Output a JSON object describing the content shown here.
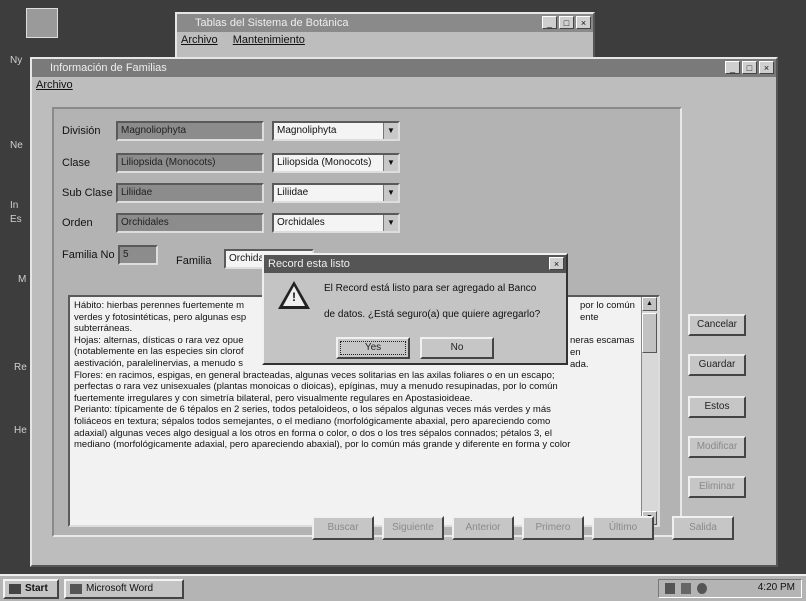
{
  "back_window": {
    "title": "Tablas del Sistema de Botánica",
    "menu": [
      "Archivo",
      "Mantenimiento"
    ]
  },
  "main_window": {
    "title": "Información de Familias",
    "menu": [
      "Archivo"
    ],
    "fields": {
      "division": {
        "label": "División",
        "value": "Magnoliophyta",
        "combo": "Magnoliphyta"
      },
      "clase": {
        "label": "Clase",
        "value": "Liliopsida (Monocots)",
        "combo": "Liliopsida (Monocots)"
      },
      "subclase": {
        "label": "Sub Clase",
        "value": "Liliidae",
        "combo": "Liliidae"
      },
      "orden": {
        "label": "Orden",
        "value": "Orchidales",
        "combo": "Orchidales"
      },
      "familia_no": {
        "label": "Familia No",
        "value": "5"
      },
      "familia": {
        "label": "Familia",
        "value": "Orchida"
      }
    },
    "description": [
      "Hábito: hierbas perennes fuertemente m",
      "verdes y fotosintéticas, pero algunas esp",
      "subterráneas.",
      "Hojas: alternas, dísticas o rara vez opue",
      "(notablemente en las especies sin clorof",
      "aestivación, paralelinervias, a menudo s",
      "Flores: en racimos, espigas, en general bracteadas, algunas veces solitarias en las axilas foliares o en un escapo;",
      "perfectas o rara vez unisexuales (plantas monoicas o dioicas), epíginas, muy a menudo resupinadas, por lo común",
      "fuertemente irregulares y con simetría bilateral, pero visualmente regulares en Apostasioideae.",
      "Perianto: típicamente de 6 tépalos en 2 series, todos petaloideos, o los sépalos algunas veces más verdes y más",
      "foliáceos en textura; sépalos todos semejantes, o el mediano (morfológicamente abaxial, pero apareciendo como",
      "adaxial) algunas veces algo desigual a los otros en forma o color, o dos o los tres sépalos connados; pétalos 3, el",
      "mediano (morfológicamente adaxial, pero apareciendo abaxial), por lo común más grande y diferente en forma y color"
    ],
    "description_right": [
      "por lo común",
      "ente",
      "neras escamas",
      "en",
      "ada."
    ],
    "side_buttons": [
      "Cancelar",
      "Guardar",
      "Estos",
      "Modificar",
      "Eliminar"
    ],
    "bottom_buttons": [
      "Buscar",
      "Siguiente",
      "Anterior",
      "Primero",
      "Último",
      "Salida"
    ]
  },
  "dialog": {
    "title": "Record esta listo",
    "icon": "warning-icon",
    "message_line1": "El Record está listo para ser agregado al Banco",
    "message_line2": "de datos. ¿Está seguro(a) que quiere agregarlo?",
    "yes_label": "Yes",
    "no_label": "No"
  },
  "desktop": {
    "labels": [
      "Ny",
      "Ne",
      "In",
      "Es",
      "M",
      "Re",
      "He"
    ]
  },
  "taskbar": {
    "start_label": "Start",
    "task_label": "Microsoft Word",
    "clock": "4:20 PM"
  }
}
